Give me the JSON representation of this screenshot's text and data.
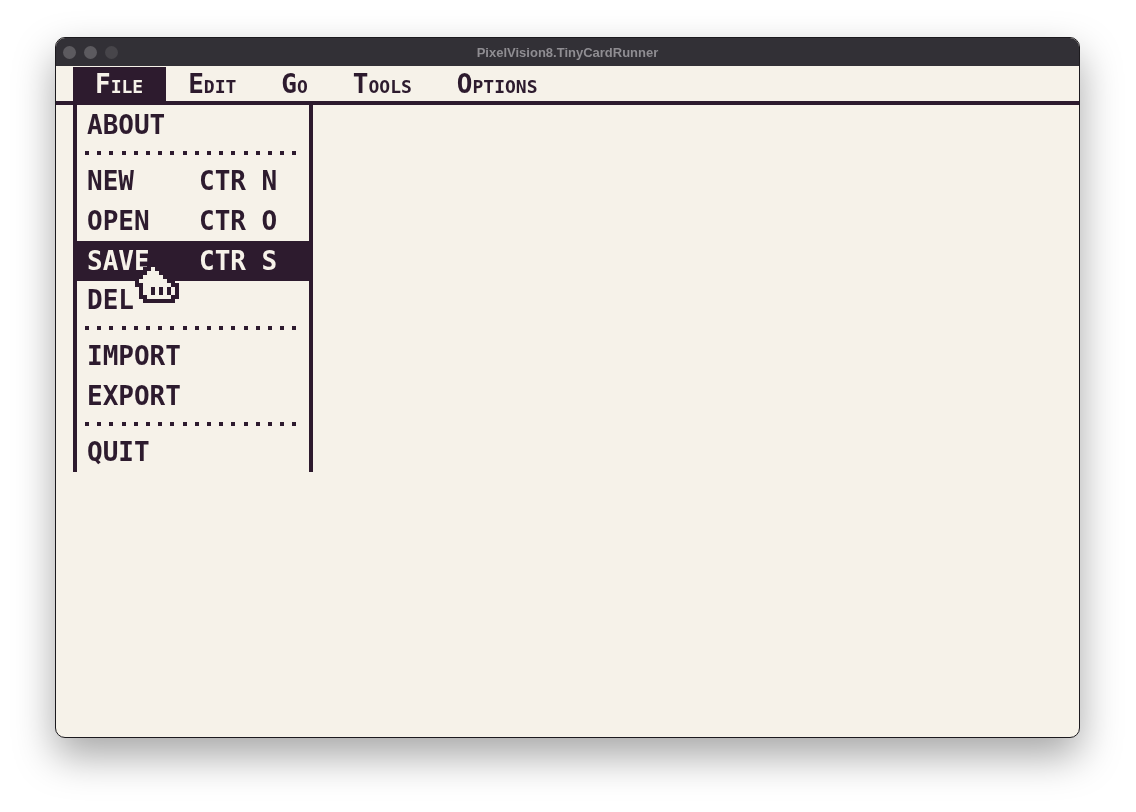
{
  "window": {
    "title": "PixelVision8.TinyCardRunner"
  },
  "menu_bar": [
    {
      "label": "File",
      "selected": true
    },
    {
      "label": "Edit",
      "selected": false
    },
    {
      "label": "Go",
      "selected": false
    },
    {
      "label": "Tools",
      "selected": false
    },
    {
      "label": "Options",
      "selected": false
    }
  ],
  "dropdown": {
    "items": [
      {
        "kind": "item",
        "label": "ABOUT",
        "selected": false
      },
      {
        "kind": "separator"
      },
      {
        "kind": "item",
        "label": "NEW",
        "shortcut": "CTR N",
        "selected": false
      },
      {
        "kind": "item",
        "label": "OPEN",
        "shortcut": "CTR O",
        "selected": false
      },
      {
        "kind": "item",
        "label": "SAVE",
        "shortcut": "CTR S",
        "selected": true
      },
      {
        "kind": "item",
        "label": "DEL",
        "selected": false
      },
      {
        "kind": "separator"
      },
      {
        "kind": "item",
        "label": "IMPORT",
        "selected": false
      },
      {
        "kind": "item",
        "label": "EXPORT",
        "selected": false
      },
      {
        "kind": "separator"
      },
      {
        "kind": "item",
        "label": "QUIT",
        "selected": false
      }
    ]
  }
}
